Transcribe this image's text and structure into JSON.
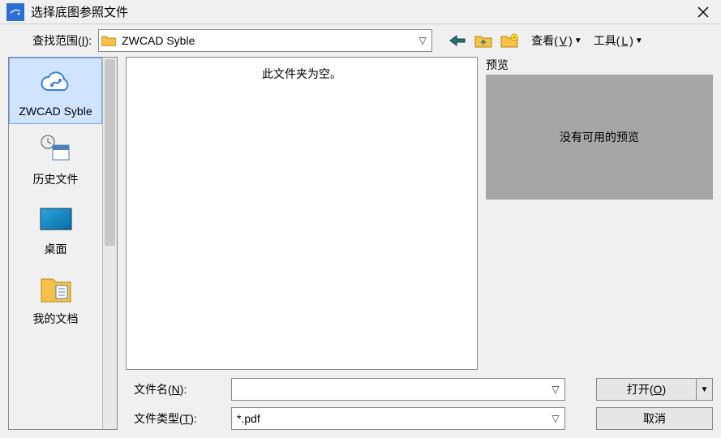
{
  "titlebar": {
    "title": "选择底图参照文件"
  },
  "topbar": {
    "range_label_pre": "查找范围(",
    "range_label_u": "I",
    "range_label_post": "):",
    "range_value": "ZWCAD Syble",
    "view_label_pre": "查看(",
    "view_label_u": "V",
    "view_label_post": ")",
    "tools_label_pre": "工具(",
    "tools_label_u": "L",
    "tools_label_post": ")"
  },
  "sidebar": {
    "items": [
      {
        "label": "ZWCAD Syble"
      },
      {
        "label": "历史文件"
      },
      {
        "label": "桌面"
      },
      {
        "label": "我的文档"
      }
    ]
  },
  "filelist": {
    "empty_text": "此文件夹为空。"
  },
  "preview": {
    "label": "预览",
    "placeholder": "没有可用的预览"
  },
  "bottom": {
    "filename_label_pre": "文件名(",
    "filename_label_u": "N",
    "filename_label_post": "):",
    "filetype_label_pre": "文件类型(",
    "filetype_label_u": "T",
    "filetype_label_post": "):",
    "filename_value": "",
    "filetype_value": "*.pdf",
    "open_label_pre": "打开(",
    "open_label_u": "O",
    "open_label_post": ")",
    "cancel_label": "取消"
  }
}
